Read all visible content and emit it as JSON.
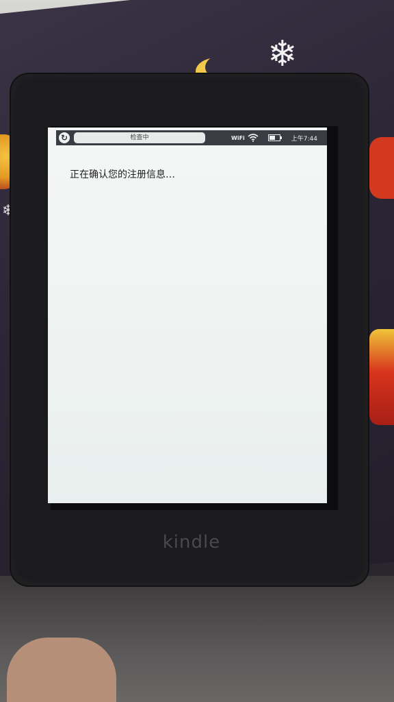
{
  "device": {
    "brand": "kindle"
  },
  "statusbar": {
    "sync_icon": "sync-icon",
    "search_text": "检查中",
    "wifi_label": "WiFi",
    "wifi_icon": "wifi-icon",
    "battery_icon": "battery-icon",
    "battery_level": 0.55,
    "time": "上午7:44"
  },
  "main": {
    "message": "正在确认您的注册信息…"
  }
}
